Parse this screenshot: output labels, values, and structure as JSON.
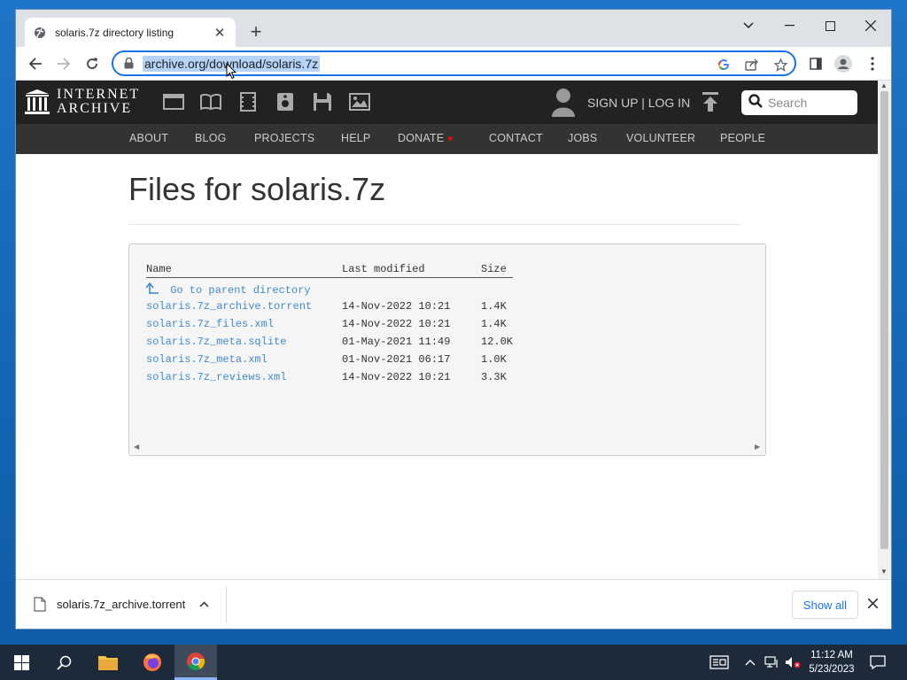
{
  "browser": {
    "tab_title": "solaris.7z directory listing",
    "url": "archive.org/download/solaris.7z"
  },
  "ia_header": {
    "logo_line1": "INTERNET",
    "logo_line2": "ARCHIVE",
    "signup": "SIGN UP | LOG IN",
    "search_placeholder": "Search",
    "menu": [
      "ABOUT",
      "BLOG",
      "PROJECTS",
      "HELP",
      "DONATE",
      "CONTACT",
      "JOBS",
      "VOLUNTEER",
      "PEOPLE"
    ]
  },
  "page": {
    "title": "Files for solaris.7z",
    "columns": [
      "Name",
      "Last modified",
      "Size"
    ],
    "parent_link": "Go to parent directory",
    "files": [
      {
        "name": "solaris.7z_archive.torrent",
        "modified": "14-Nov-2022 10:21",
        "size": "1.4K"
      },
      {
        "name": "solaris.7z_files.xml",
        "modified": "14-Nov-2022 10:21",
        "size": "1.4K"
      },
      {
        "name": "solaris.7z_meta.sqlite",
        "modified": "01-May-2021 11:49",
        "size": "12.0K"
      },
      {
        "name": "solaris.7z_meta.xml",
        "modified": "01-Nov-2021 06:17",
        "size": "1.0K"
      },
      {
        "name": "solaris.7z_reviews.xml",
        "modified": "14-Nov-2022 10:21",
        "size": "3.3K"
      }
    ]
  },
  "download_bar": {
    "filename": "solaris.7z_archive.torrent",
    "show_all": "Show all"
  },
  "taskbar": {
    "time": "11:12 AM",
    "date": "5/23/2023"
  },
  "colors": {
    "link": "#428bca",
    "ia_dark": "#222222",
    "ia_menu": "#333333",
    "url_highlight": "#b4d3f7",
    "chrome_blue": "#1a73e8"
  }
}
